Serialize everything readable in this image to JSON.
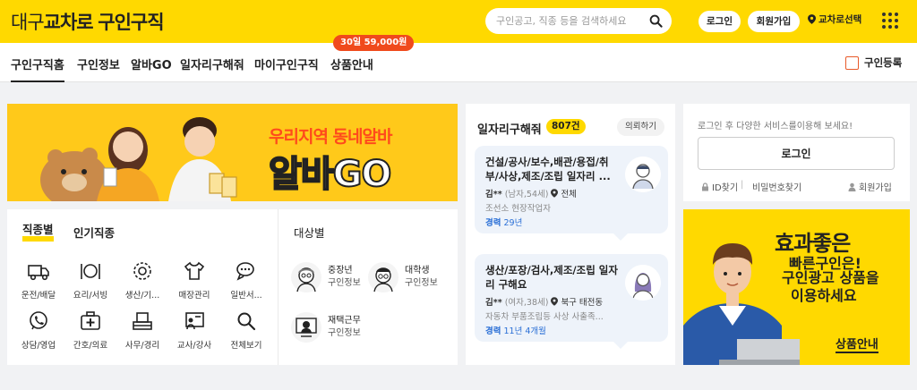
{
  "header": {
    "logo_light": "대구",
    "logo_bold": "교차로",
    "logo_suffix": "구인구직",
    "search_placeholder": "구인공고, 직종 등을 검색하세요",
    "login": "로그인",
    "signup": "회원가입",
    "location": "교차로선택"
  },
  "nav": {
    "items": [
      "구인구직홈",
      "구인정보",
      "알바GO",
      "일자리구해줘",
      "마이구인구직",
      "상품안내"
    ],
    "promo": "30일 59,000원",
    "register": "구인등록"
  },
  "banner": {
    "line1": "우리지역 동네알바",
    "line2": "알바GO"
  },
  "categories": {
    "tabs": [
      "직종별",
      "인기직종"
    ],
    "items": [
      {
        "label": "운전/배달",
        "icon": "truck-icon"
      },
      {
        "label": "요리/서빙",
        "icon": "dining-icon"
      },
      {
        "label": "생산/기...",
        "icon": "gear-icon"
      },
      {
        "label": "매장관리",
        "icon": "shirt-icon"
      },
      {
        "label": "일반서...",
        "icon": "chat-icon"
      },
      {
        "label": "상담/영업",
        "icon": "phone-icon"
      },
      {
        "label": "간호/의료",
        "icon": "medical-icon"
      },
      {
        "label": "사무/경리",
        "icon": "office-icon"
      },
      {
        "label": "교사/강사",
        "icon": "teacher-icon"
      },
      {
        "label": "전체보기",
        "icon": "search-icon"
      }
    ],
    "target_title": "대상별",
    "targets": [
      {
        "name": "중장년",
        "sub": "구인정보"
      },
      {
        "name": "대학생",
        "sub": "구인정보"
      },
      {
        "name": "재택근무",
        "sub": "구인정보"
      }
    ]
  },
  "jobs": {
    "title": "일자리구해줘",
    "count": "807건",
    "request": "의뢰하기",
    "list": [
      {
        "title": "건설/공사/보수,배관/용접/취부/사상,제조/조립 일자리 ...",
        "name": "김**",
        "info": "(남자,54세)",
        "region": "전체",
        "company": "조선소 현장작업자",
        "exp_label": "경력",
        "exp_value": "29년"
      },
      {
        "title": "생산/포장/검사,제조/조립 일자리 구해요",
        "name": "김**",
        "info": "(여자,38세)",
        "region": "북구 태전동",
        "company": "자동차 부품조립등 사상 사출족...",
        "exp_label": "경력",
        "exp_value": "11년 4개월"
      }
    ]
  },
  "login_box": {
    "message": "로그인 후 다양한 서비스를이용해 보세요!",
    "button": "로그인",
    "find_id": "ID찾기",
    "find_pw": "비밀번호찾기",
    "join": "회원가입"
  },
  "ad": {
    "line1": "효과좋은",
    "line2": "빠른구인은!",
    "line3": "구인광고 상품을",
    "line4": "이용하세요",
    "button": "상품안내"
  },
  "colors": {
    "brand_yellow": "#ffd900",
    "promo_red": "#f04a1c",
    "link_blue": "#2a6fd6"
  }
}
